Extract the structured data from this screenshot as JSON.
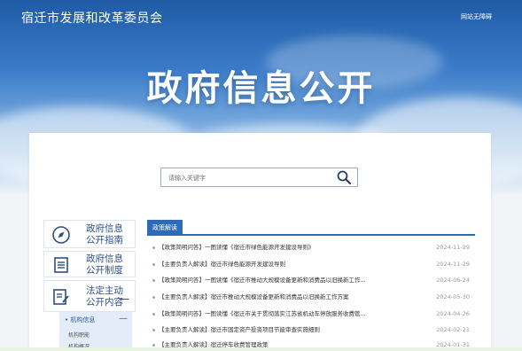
{
  "header": {
    "site_name": "宿迁市发展和改革委员会",
    "accessibility_link": "网站无障碍",
    "hero_title": "政府信息公开"
  },
  "search": {
    "placeholder": "请输入关键字"
  },
  "sidebar": {
    "cards": [
      {
        "label_line1": "政府信息",
        "label_line2": "公开指南",
        "icon": "compass-icon"
      },
      {
        "label_line1": "政府信息",
        "label_line2": "公开制度",
        "icon": "document-list-icon"
      },
      {
        "label_line1": "法定主动",
        "label_line2": "公开内容",
        "icon": "document-edit-icon",
        "collapse": "—"
      }
    ],
    "sub_nav": {
      "head": "• 机构信息",
      "minus": "—",
      "items": [
        "机构职能",
        "机构概况"
      ]
    }
  },
  "news": {
    "tab_label": "政策解读",
    "rows": [
      {
        "title": "【政策简明问答】一图读懂《宿迁市绿色能源开发建设导则》",
        "date": "2024-11-29"
      },
      {
        "title": "【主要负责人解读】宿迁市绿色能源开发建设导则",
        "date": "2024-11-29"
      },
      {
        "title": "【政策简明问答】一图读懂《宿迁市推动大规模设备更新和消费品以旧换新工作...",
        "date": "2024-06-24"
      },
      {
        "title": "【主要负责人解读】宿迁市推动大规模设备更新和消费品以旧换新工作方案",
        "date": "2024-05-30"
      },
      {
        "title": "【政策简明问答】一图读懂《宿迁市关于贯彻落实江苏省机动车停放服务收费管...",
        "date": "2024-04-26"
      },
      {
        "title": "【主要负责人解读】宿迁市固定资产投资项目节能审查实施细则",
        "date": "2024-02-21"
      },
      {
        "title": "【主要负责人解读】宿迁停车收费管理政策",
        "date": "2024-01-31"
      }
    ]
  },
  "colors": {
    "brand_blue": "#2d6bb8",
    "nav_text": "#2c4f86"
  }
}
